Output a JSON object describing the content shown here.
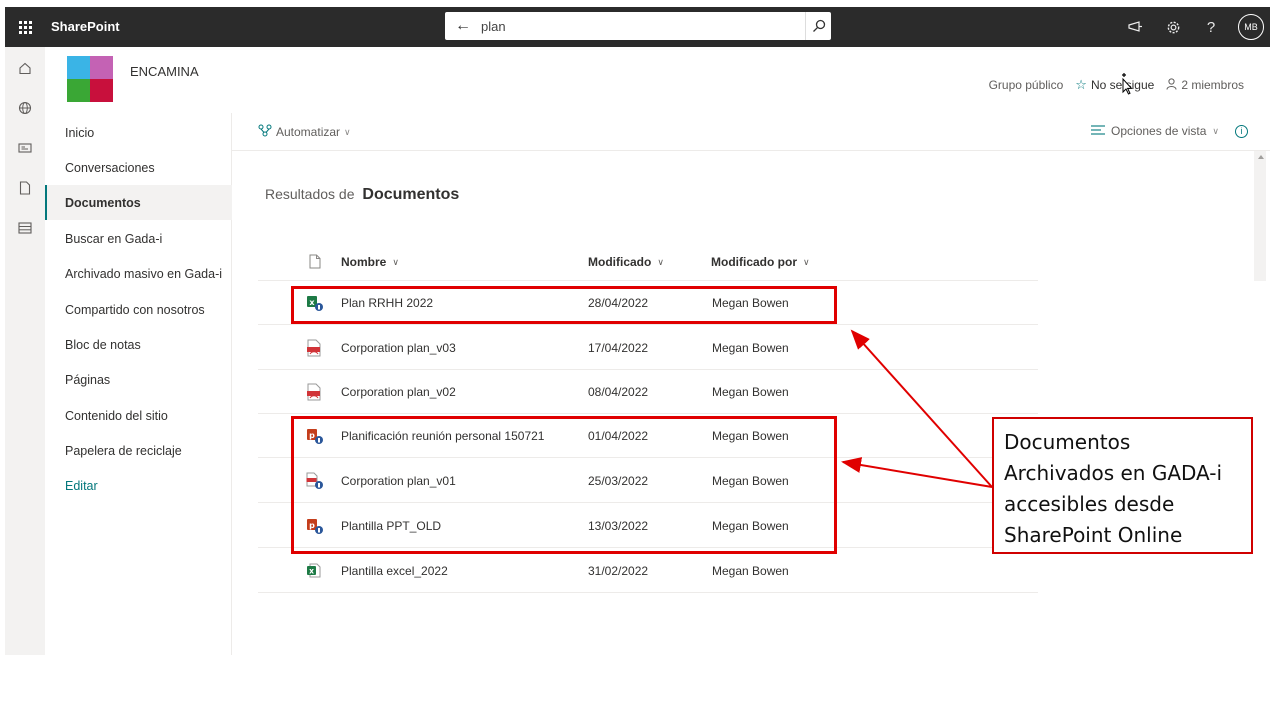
{
  "suitebar": {
    "brand": "SharePoint",
    "search_value": "plan",
    "avatar_initials": "MB"
  },
  "site": {
    "name": "ENCAMINA",
    "meta": {
      "group": "Grupo público",
      "follow": "No se sigue",
      "members": "2 miembros"
    },
    "logo_colors": [
      "#3ab4e6",
      "#c462b4",
      "#3aa735",
      "#c8103c"
    ]
  },
  "nav": {
    "items": [
      {
        "label": "Inicio"
      },
      {
        "label": "Conversaciones"
      },
      {
        "label": "Documentos"
      },
      {
        "label": "Buscar en Gada-i"
      },
      {
        "label": "Archivado masivo en Gada-i"
      },
      {
        "label": "Compartido con nosotros"
      },
      {
        "label": "Bloc de notas"
      },
      {
        "label": "Páginas"
      },
      {
        "label": "Contenido del sitio"
      },
      {
        "label": "Papelera de reciclaje"
      }
    ],
    "active": "Documentos",
    "edit_label": "Editar"
  },
  "cmdbar": {
    "automate_label": "Automatizar",
    "view_options_label": "Opciones de vista"
  },
  "results": {
    "prefix": "Resultados de",
    "library": "Documentos"
  },
  "table": {
    "columns": {
      "name": "Nombre",
      "modified": "Modificado",
      "modified_by": "Modificado por"
    },
    "rows": [
      {
        "icon": "excel-archived-icon",
        "name": "Plan RRHH 2022",
        "modified": "28/04/2022",
        "modified_by": "Megan Bowen"
      },
      {
        "icon": "pdf-icon",
        "name": "Corporation plan_v03",
        "modified": "17/04/2022",
        "modified_by": "Megan Bowen"
      },
      {
        "icon": "pdf-icon",
        "name": "Corporation plan_v02",
        "modified": "08/04/2022",
        "modified_by": "Megan Bowen"
      },
      {
        "icon": "powerpoint-archived-icon",
        "name": "Planificación reunión personal 150721",
        "modified": "01/04/2022",
        "modified_by": "Megan Bowen"
      },
      {
        "icon": "pdf-archived-icon",
        "name": "Corporation plan_v01",
        "modified": "25/03/2022",
        "modified_by": "Megan Bowen"
      },
      {
        "icon": "powerpoint-archived-icon",
        "name": "Plantilla PPT_OLD",
        "modified": "13/03/2022",
        "modified_by": "Megan Bowen"
      },
      {
        "icon": "excel-icon",
        "name": "Plantilla excel_2022",
        "modified": "31/02/2022",
        "modified_by": "Megan Bowen"
      }
    ]
  },
  "annotation": {
    "lines": [
      "Documentos",
      "Archivados en GADA-i",
      "accesibles desde",
      "SharePoint Online"
    ],
    "color": "#e00000"
  }
}
